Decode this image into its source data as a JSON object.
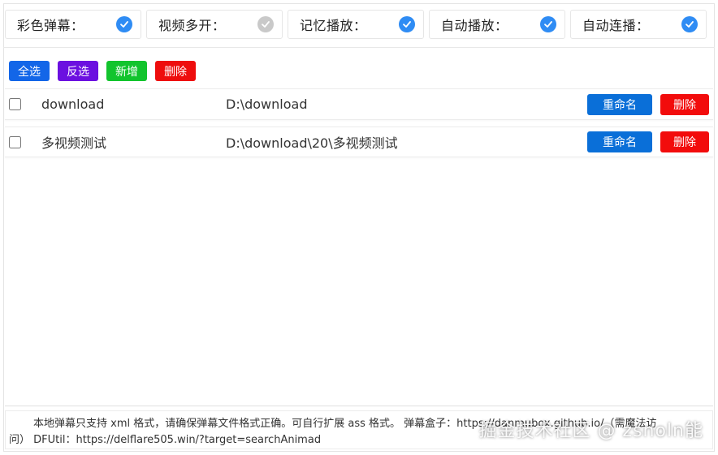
{
  "options": [
    {
      "label": "彩色弹幕：",
      "checked": true
    },
    {
      "label": "视频多开：",
      "checked": false
    },
    {
      "label": "记忆播放：",
      "checked": true
    },
    {
      "label": "自动播放：",
      "checked": true
    },
    {
      "label": "自动连播：",
      "checked": true
    }
  ],
  "toolbar": {
    "select_all": "全选",
    "invert": "反选",
    "add": "新增",
    "delete": "删除"
  },
  "rows": [
    {
      "name": "download",
      "path": "D:\\download",
      "rename": "重命名",
      "delete": "删除"
    },
    {
      "name": "多视频测试",
      "path": "D:\\download\\20\\多视频测试",
      "rename": "重命名",
      "delete": "删除"
    }
  ],
  "footer": {
    "line1": "本地弹幕只支持 xml 格式，请确保弹幕文件格式正确。可自行扩展 ass 格式。 弹幕盒子：https://danmubox.github.io/（需魔法访",
    "line2": "问） DFUtil：https://delflare505.win/?target=searchAnimad"
  },
  "watermark": "掘金技术社区 @ zsnoln能",
  "colors": {
    "check_on": "#2f8cf4",
    "check_off": "#c9c9c9",
    "blue": "#1366e8",
    "purple": "#6b10e0",
    "green": "#12c42d",
    "red": "#ee0d0d"
  }
}
